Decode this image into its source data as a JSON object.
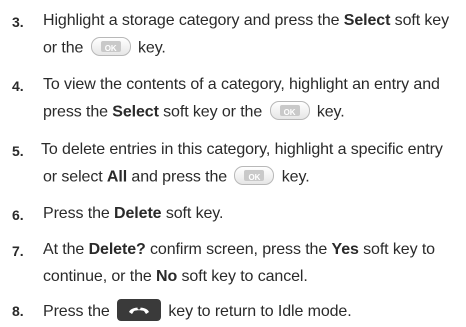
{
  "steps": [
    {
      "num": "3.",
      "l1": {
        "a": "Highlight a storage category and press the ",
        "b": "Select",
        "c": " soft key"
      },
      "l2": {
        "a": "or the ",
        "key": "OK",
        "c": " key."
      }
    },
    {
      "num": "4.",
      "l1": {
        "a": "To view the contents of a category, highlight an entry and"
      },
      "l2": {
        "a": "press the ",
        "b": "Select",
        "c": " soft key or the ",
        "key": "OK",
        "d": " key."
      }
    },
    {
      "num": "5.",
      "l1": {
        "a": " To delete entries in this category, highlight a specific entry"
      },
      "l2": {
        "a": "or select ",
        "b": "All",
        "c": " and press the ",
        "key": "OK",
        "d": " key."
      }
    },
    {
      "num": "6.",
      "l1": {
        "a": "Press the ",
        "b": "Delete",
        "c": " soft key."
      }
    },
    {
      "num": "7.",
      "l1": {
        "a": "At the ",
        "b": "Delete?",
        "c": " confirm screen, press the ",
        "b2": "Yes",
        "d": " soft key to"
      },
      "l2": {
        "a": "continue, or the ",
        "b": "No",
        "c": " soft key to cancel."
      }
    },
    {
      "num": "8.",
      "l1": {
        "a": "Press the ",
        "c": " key to return to Idle mode."
      }
    }
  ],
  "icons": {
    "ok_key": "ok-key-icon",
    "end_key": "end-power-key-icon"
  }
}
